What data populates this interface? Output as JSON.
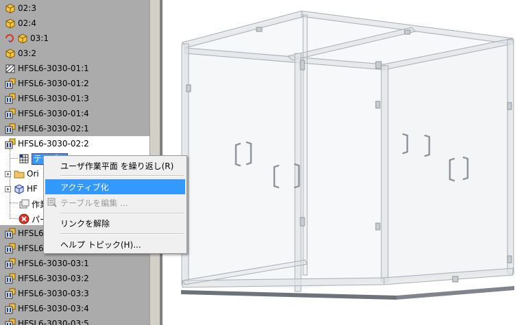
{
  "tree": {
    "items_top": [
      {
        "label": "02:3",
        "icon": "part-icon"
      },
      {
        "label": "02:4",
        "icon": "part-icon"
      },
      {
        "label": "03:1",
        "icon": "part-adaptive-icon"
      },
      {
        "label": "03:2",
        "icon": "part-icon"
      },
      {
        "label": "HFSL6-3030-01:1",
        "icon": "frame-member-icon"
      },
      {
        "label": "HFSL6-3030-01:2",
        "icon": "frame-member-icon"
      },
      {
        "label": "HFSL6-3030-01:3",
        "icon": "frame-member-icon"
      },
      {
        "label": "HFSL6-3030-01:4",
        "icon": "frame-member-icon"
      },
      {
        "label": "HFSL6-3030-02:1",
        "icon": "frame-member-icon"
      },
      {
        "label": "HFSL6-3030-02:2",
        "icon": "frame-member-icon"
      }
    ],
    "child_table": "テーブル",
    "child_origin": "Ori",
    "child_hf": "HF",
    "child_work": "作業",
    "child_part": "パー",
    "items_bottom": [
      {
        "label": "HFSL6",
        "icon": "frame-member-icon"
      },
      {
        "label": "HFSL6",
        "icon": "frame-member-icon"
      },
      {
        "label": "HFSL6-3030-03:1",
        "icon": "frame-member-icon"
      },
      {
        "label": "HFSL6-3030-03:2",
        "icon": "frame-member-icon"
      },
      {
        "label": "HFSL6-3030-03:3",
        "icon": "frame-member-icon"
      },
      {
        "label": "HFSL6-3030-03:4",
        "icon": "frame-member-icon"
      },
      {
        "label": "HFSL6-3030-03:5",
        "icon": "frame-member-icon"
      }
    ]
  },
  "context_menu": {
    "items": [
      {
        "label": "ユーザ作業平面 を繰り返し(R)",
        "state": "normal"
      },
      {
        "label": "アクティブ化",
        "state": "highlight"
      },
      {
        "label": "テーブルを編集 ...",
        "state": "disabled"
      },
      {
        "label": "リンクを解除",
        "state": "normal"
      },
      {
        "label": "ヘルプ トピック(H)...",
        "state": "normal"
      }
    ]
  },
  "colors": {
    "tree_background": "#ababab",
    "selection": "#3399ff",
    "menu_background": "#f0f0f0",
    "model_edge": "#9aa0a6"
  }
}
